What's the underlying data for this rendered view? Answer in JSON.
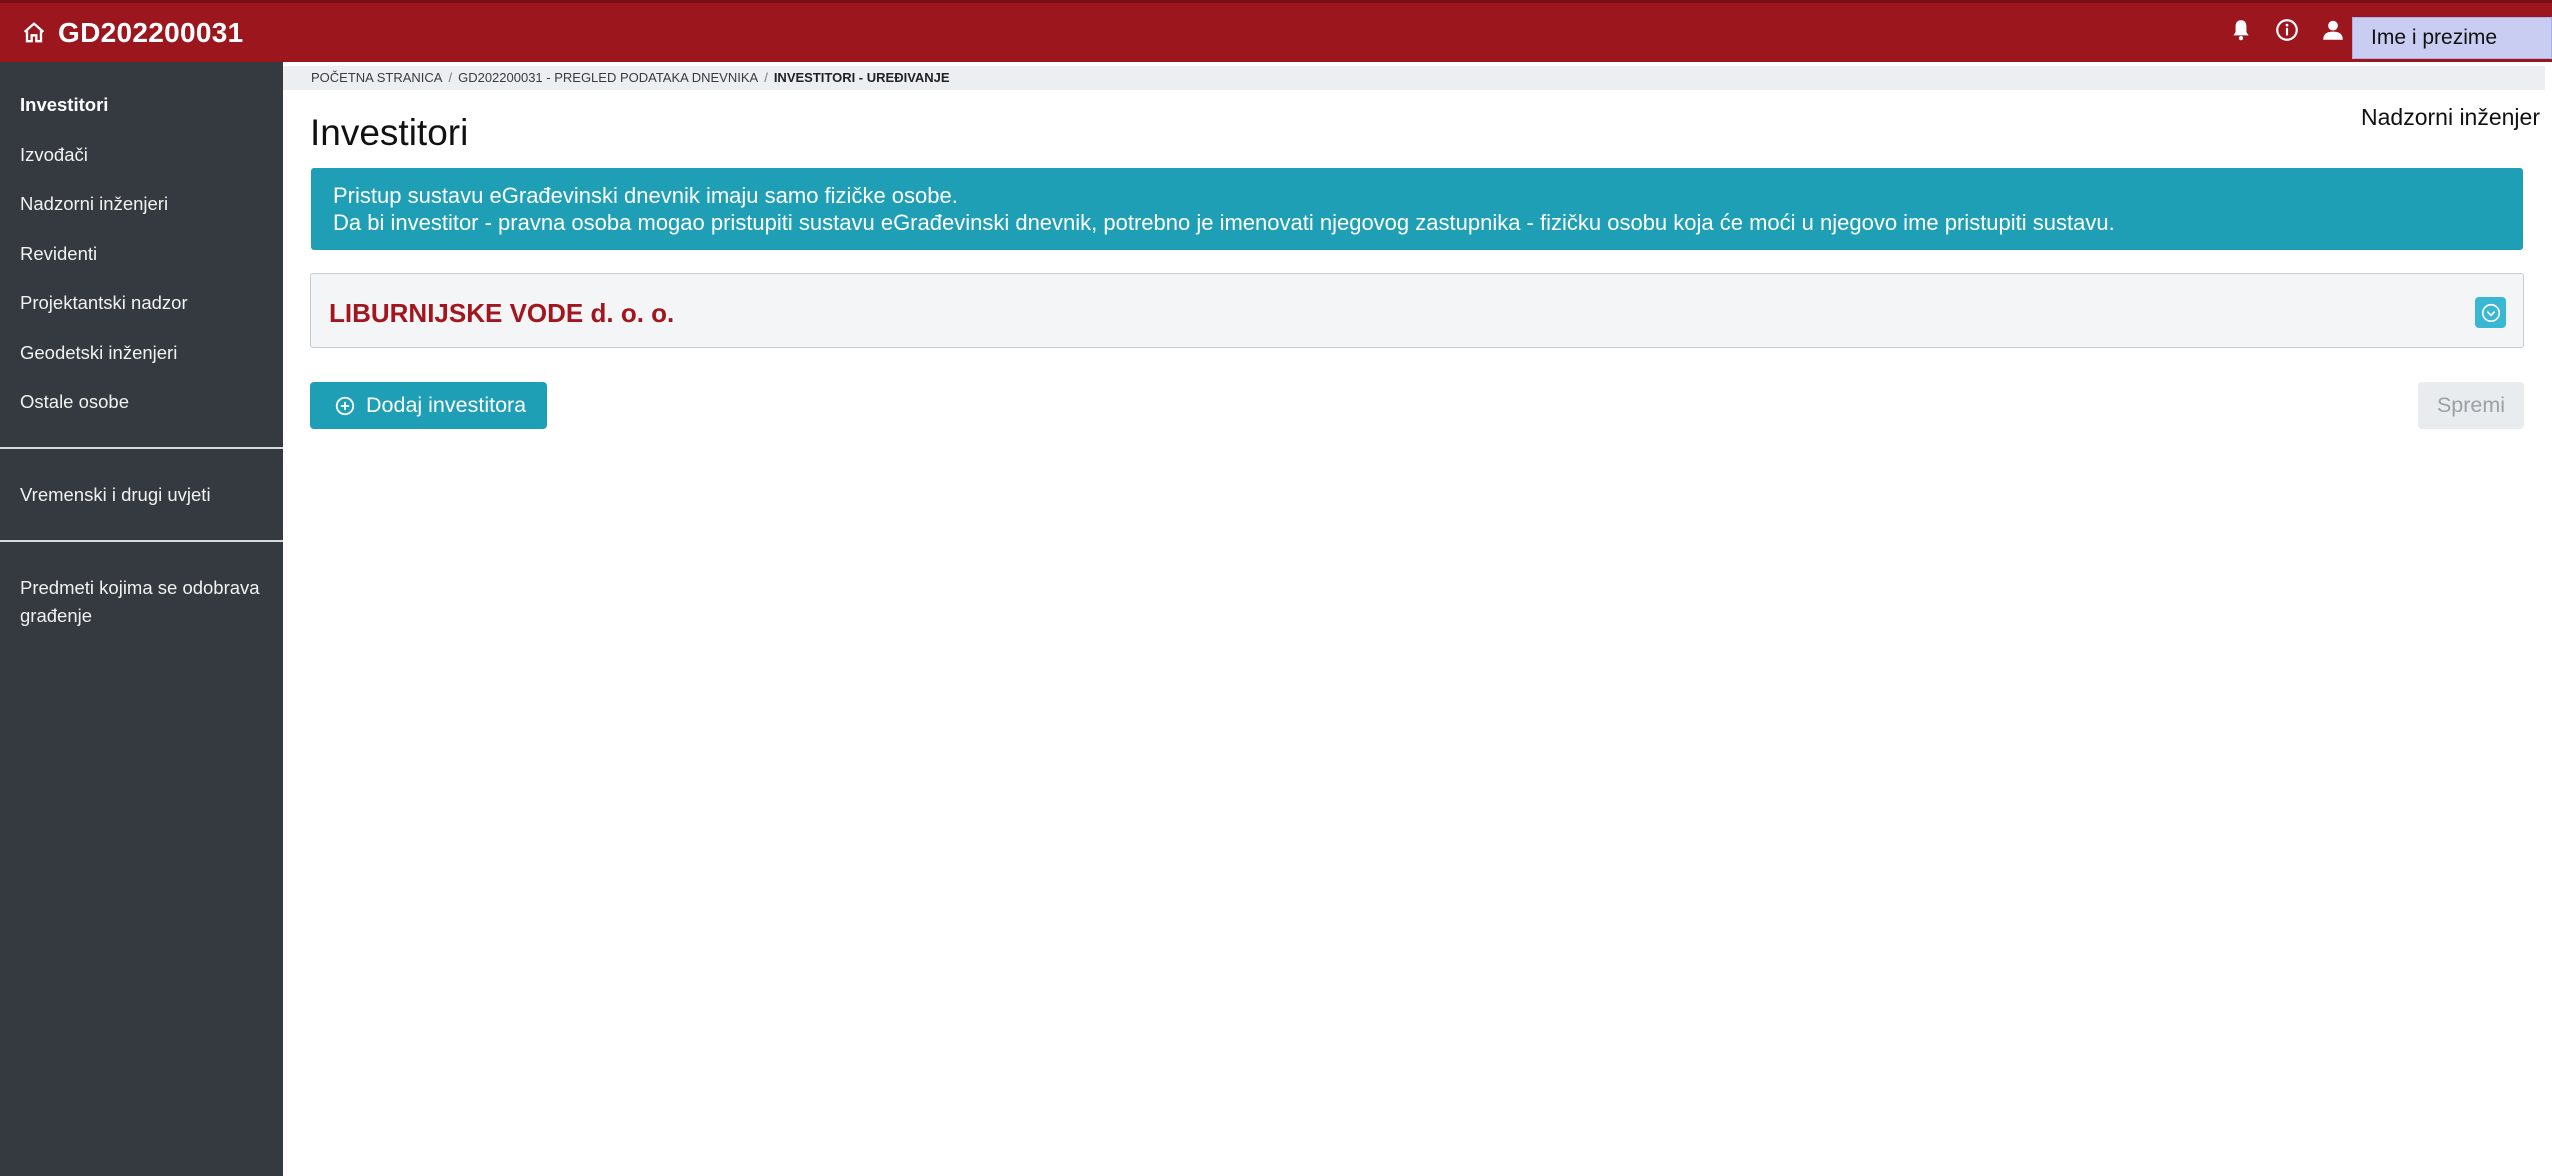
{
  "header": {
    "title": "GD202200031",
    "home_icon": "home-icon",
    "icons": [
      "bell-icon",
      "info-icon",
      "user-icon"
    ],
    "user_name": "Ime i prezime",
    "role": "Nadzorni inženjer",
    "brand_color": "#9c161e"
  },
  "sidebar": {
    "items": [
      {
        "label": "Investitori",
        "active": true
      },
      {
        "label": "Izvođači"
      },
      {
        "label": "Nadzorni inženjeri"
      },
      {
        "label": "Revidenti"
      },
      {
        "label": "Projektantski nadzor"
      },
      {
        "label": "Geodetski inženjeri"
      },
      {
        "label": "Ostale osobe"
      },
      {
        "label": "Vremenski i drugi uvjeti"
      },
      {
        "label": "Predmeti kojima se odobrava građenje"
      }
    ]
  },
  "breadcrumb": {
    "home": "POČETNA STRANICA",
    "diary": "GD202200031 - PREGLED PODATAKA DNEVNIKA",
    "current": "INVESTITORI - UREĐIVANJE"
  },
  "main": {
    "title": "Investitori",
    "info_line1": "Pristup sustavu eGrađevinski dnevnik imaju samo fizičke osobe.",
    "info_line2": "Da bi investitor - pravna osoba mogao pristupiti sustavu eGrađevinski dnevnik, potrebno je imenovati njegovog zastupnika - fizičku osobu koja će moći u njegovo ime pristupiti sustavu.",
    "investor_name": "LIBURNIJSKE VODE d. o. o.",
    "add_button": "Dodaj investitora",
    "save_button": "Spremi",
    "accent_color": "#1f9fb6"
  }
}
